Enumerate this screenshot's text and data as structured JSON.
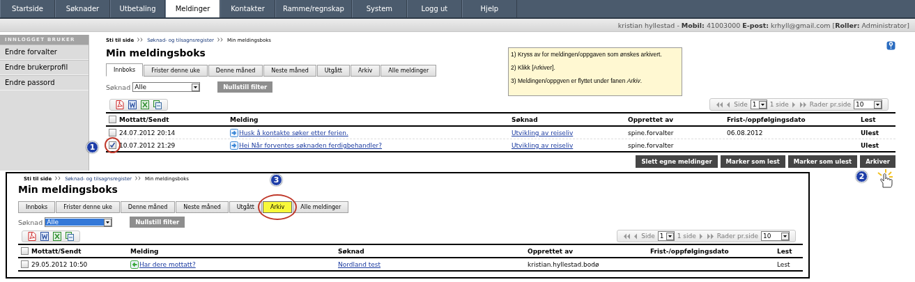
{
  "nav": [
    {
      "label": "Startside",
      "selected": false
    },
    {
      "label": "Søknader",
      "selected": false
    },
    {
      "label": "Utbetaling",
      "selected": false
    },
    {
      "label": "Meldinger",
      "selected": true
    },
    {
      "label": "Kontakter",
      "selected": false
    },
    {
      "label": "Ramme/regnskap",
      "selected": false
    },
    {
      "label": "System",
      "selected": false
    },
    {
      "label": "Logg ut",
      "selected": false
    },
    {
      "label": "Hjelp",
      "selected": false
    }
  ],
  "user_bar": "kristian hyllestad - **Mobil:** 41003000 **E-post:** krhyll@gmail.com [**Roller:** Administrator]",
  "sidebar": {
    "title": "INNLOGGET BRUKER",
    "items": [
      "Endre forvalter",
      "Endre brukerprofil",
      "Endre passord"
    ]
  },
  "note": [
    "1) Kryss av for meldingen/oppgaven som ønskes arkivert.",
    "2) Klikk [Arkiver].",
    "3) Meldingen/oppgven er flyttet under fanen *Arkiv*."
  ],
  "mailbox": {
    "breadcrumb": [
      "Sti til side",
      "Søknad- og tilsagnsregister",
      "Min meldingsboks"
    ],
    "title": "Min meldingsboks",
    "tabs": [
      {
        "label": "Innboks",
        "selected": true,
        "highlighted": false
      },
      {
        "label": "Frister denne uke",
        "selected": false,
        "highlighted": false
      },
      {
        "label": "Denne måned",
        "selected": false,
        "highlighted": false
      },
      {
        "label": "Neste måned",
        "selected": false,
        "highlighted": false
      },
      {
        "label": "Utgått",
        "selected": false,
        "highlighted": false
      },
      {
        "label": "Arkiv",
        "selected": false,
        "highlighted": false
      },
      {
        "label": "Alle meldinger",
        "selected": false,
        "highlighted": false
      }
    ],
    "filter": {
      "label": "Søknad",
      "value": "Alle",
      "focused": false,
      "reset": "Nullstill filter"
    },
    "pager": {
      "side": "Side",
      "page": "1",
      "pages": "1 side",
      "rows_label": "Rader pr.side",
      "rows": "10"
    },
    "columns": [
      "Mottatt/Sendt",
      "Melding",
      "Søknad",
      "Opprettet av",
      "Frist-/oppfølgingsdato",
      "Lest"
    ],
    "all_checked": false,
    "rows": [
      {
        "checked": false,
        "received": "24.07.2012 20:14",
        "kind": "outgoing",
        "message": "Husk å kontakte søker etter ferien.",
        "application": "Utvikling av reiseliv",
        "created_by": "spine.forvalter",
        "due": "06.08.2012",
        "status": "Ulest",
        "unread": true
      },
      {
        "checked": true,
        "received": "10.07.2012 21:29",
        "kind": "outgoing",
        "message": "Hei Når forventes søknaden ferdigbehandler?",
        "application": "Utvikling av reiseliv",
        "created_by": "spine.forvalter",
        "status": "Ulest",
        "unread": true
      }
    ],
    "actions": [
      "Slett egne meldinger",
      "Marker som lest",
      "Marker som ulest",
      "Arkiver"
    ]
  },
  "archive_view": {
    "breadcrumb": [
      "Sti til side",
      "Søknad- og tilsagnsregister",
      "Min meldingsboks"
    ],
    "title": "Min meldingsboks",
    "tabs": [
      {
        "label": "Innboks",
        "selected": false,
        "highlighted": false
      },
      {
        "label": "Frister denne uke",
        "selected": false,
        "highlighted": false
      },
      {
        "label": "Denne måned",
        "selected": false,
        "highlighted": false
      },
      {
        "label": "Neste måned",
        "selected": false,
        "highlighted": false
      },
      {
        "label": "Utgått",
        "selected": false,
        "highlighted": false
      },
      {
        "label": "Arkiv",
        "selected": true,
        "highlighted": true
      },
      {
        "label": "Alle meldinger",
        "selected": false,
        "highlighted": false
      }
    ],
    "filter": {
      "label": "Søknad",
      "value": "Alle",
      "focused": true,
      "reset": "Nullstill filter"
    },
    "pager": {
      "side": "Side",
      "page": "1",
      "pages": "1 side",
      "rows_label": "Rader pr.side",
      "rows": "10"
    },
    "columns": [
      "Mottatt/Sendt",
      "Melding",
      "Søknad",
      "Opprettet av",
      "Frist-/oppfølgingsdato",
      "Lest"
    ],
    "all_checked": false,
    "rows": [
      {
        "checked": false,
        "received": "29.05.2012 10:50",
        "kind": "incoming",
        "message": "Har dere mottatt?",
        "application": "Nordland test",
        "created_by": "kristian.hyllestad.bodø",
        "status": "Lest",
        "unread": false
      }
    ]
  },
  "annotations": [
    {
      "label": "1"
    },
    {
      "label": "2"
    },
    {
      "label": "3"
    }
  ]
}
